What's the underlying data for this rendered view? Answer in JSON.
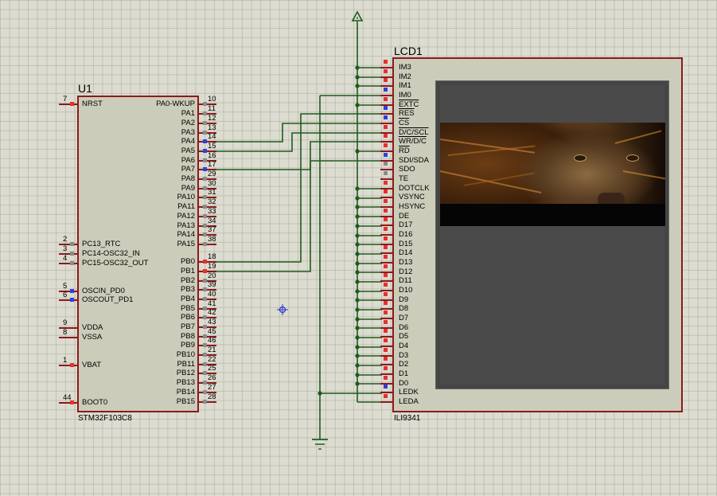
{
  "u1": {
    "ref": "U1",
    "part": "STM32F103C8",
    "left_pins": [
      {
        "num": "7",
        "label": "NRST",
        "marker": "red"
      },
      {
        "num": "2",
        "label": "PC13_RTC",
        "marker": "gray"
      },
      {
        "num": "3",
        "label": "PC14-OSC32_IN",
        "marker": "gray"
      },
      {
        "num": "4",
        "label": "PC15-OSC32_OUT",
        "marker": "gray"
      },
      {
        "num": "5",
        "label": "OSCIN_PD0",
        "marker": "blue"
      },
      {
        "num": "6",
        "label": "OSCOUT_PD1",
        "marker": "blue"
      },
      {
        "num": "9",
        "label": "VDDA",
        "marker": "none"
      },
      {
        "num": "8",
        "label": "VSSA",
        "marker": "none"
      },
      {
        "num": "1",
        "label": "VBAT",
        "marker": "red"
      },
      {
        "num": "44",
        "label": "BOOT0",
        "marker": "red"
      }
    ],
    "right_pins": [
      {
        "num": "10",
        "label": "PA0-WKUP",
        "marker": "gray"
      },
      {
        "num": "11",
        "label": "PA1",
        "marker": "gray"
      },
      {
        "num": "12",
        "label": "PA2",
        "marker": "gray"
      },
      {
        "num": "13",
        "label": "PA3",
        "marker": "gray"
      },
      {
        "num": "14",
        "label": "PA4",
        "marker": "blue"
      },
      {
        "num": "15",
        "label": "PA5",
        "marker": "blue"
      },
      {
        "num": "16",
        "label": "PA6",
        "marker": "gray"
      },
      {
        "num": "17",
        "label": "PA7",
        "marker": "blue"
      },
      {
        "num": "29",
        "label": "PA8",
        "marker": "gray"
      },
      {
        "num": "30",
        "label": "PA9",
        "marker": "gray"
      },
      {
        "num": "31",
        "label": "PA10",
        "marker": "gray"
      },
      {
        "num": "32",
        "label": "PA11",
        "marker": "gray"
      },
      {
        "num": "33",
        "label": "PA12",
        "marker": "gray"
      },
      {
        "num": "34",
        "label": "PA13",
        "marker": "gray"
      },
      {
        "num": "37",
        "label": "PA14",
        "marker": "gray"
      },
      {
        "num": "38",
        "label": "PA15",
        "marker": "gray"
      },
      {
        "num": "18",
        "label": "PB0",
        "marker": "red"
      },
      {
        "num": "19",
        "label": "PB1",
        "marker": "red"
      },
      {
        "num": "20",
        "label": "PB2",
        "marker": "gray"
      },
      {
        "num": "39",
        "label": "PB3",
        "marker": "gray"
      },
      {
        "num": "40",
        "label": "PB4",
        "marker": "gray"
      },
      {
        "num": "41",
        "label": "PB5",
        "marker": "gray"
      },
      {
        "num": "42",
        "label": "PB6",
        "marker": "gray"
      },
      {
        "num": "43",
        "label": "PB7",
        "marker": "gray"
      },
      {
        "num": "45",
        "label": "PB8",
        "marker": "gray"
      },
      {
        "num": "46",
        "label": "PB9",
        "marker": "gray"
      },
      {
        "num": "21",
        "label": "PB10",
        "marker": "gray"
      },
      {
        "num": "22",
        "label": "PB11",
        "marker": "gray"
      },
      {
        "num": "25",
        "label": "PB12",
        "marker": "gray"
      },
      {
        "num": "26",
        "label": "PB13",
        "marker": "gray"
      },
      {
        "num": "27",
        "label": "PB14",
        "marker": "gray"
      },
      {
        "num": "28",
        "label": "PB15",
        "marker": "gray"
      }
    ]
  },
  "lcd": {
    "ref": "LCD1",
    "part": "ILI9341",
    "pins": [
      {
        "label": "IM3",
        "marker": "red",
        "overline": false
      },
      {
        "label": "IM2",
        "marker": "red",
        "overline": false
      },
      {
        "label": "IM1",
        "marker": "red",
        "overline": false
      },
      {
        "label": "IM0",
        "marker": "blue",
        "overline": false
      },
      {
        "label": "EXTC",
        "marker": "red",
        "overline": true
      },
      {
        "label": "RES",
        "marker": "blue",
        "overline": true
      },
      {
        "label": "CS",
        "marker": "blue",
        "overline": true
      },
      {
        "label": "D/C/SCL",
        "marker": "red",
        "overline": true
      },
      {
        "label": "WR/D/C",
        "marker": "red",
        "overline": true
      },
      {
        "label": "RD",
        "marker": "red",
        "overline": true
      },
      {
        "label": "SDI/SDA",
        "marker": "blue",
        "overline": false
      },
      {
        "label": "SDO",
        "marker": "gray",
        "overline": false
      },
      {
        "label": "TE",
        "marker": "gray",
        "overline": false
      },
      {
        "label": "DOTCLK",
        "marker": "red",
        "overline": false
      },
      {
        "label": "VSYNC",
        "marker": "red",
        "overline": false
      },
      {
        "label": "HSYNC",
        "marker": "red",
        "overline": false
      },
      {
        "label": "DE",
        "marker": "red",
        "overline": false
      },
      {
        "label": "D17",
        "marker": "red",
        "overline": false
      },
      {
        "label": "D16",
        "marker": "red",
        "overline": false
      },
      {
        "label": "D15",
        "marker": "red",
        "overline": false
      },
      {
        "label": "D14",
        "marker": "red",
        "overline": false
      },
      {
        "label": "D13",
        "marker": "red",
        "overline": false
      },
      {
        "label": "D12",
        "marker": "red",
        "overline": false
      },
      {
        "label": "D11",
        "marker": "red",
        "overline": false
      },
      {
        "label": "D10",
        "marker": "red",
        "overline": false
      },
      {
        "label": "D9",
        "marker": "red",
        "overline": false
      },
      {
        "label": "D8",
        "marker": "red",
        "overline": false
      },
      {
        "label": "D7",
        "marker": "red",
        "overline": false
      },
      {
        "label": "D6",
        "marker": "red",
        "overline": false
      },
      {
        "label": "D5",
        "marker": "red",
        "overline": false
      },
      {
        "label": "D4",
        "marker": "red",
        "overline": false
      },
      {
        "label": "D3",
        "marker": "red",
        "overline": false
      },
      {
        "label": "D2",
        "marker": "red",
        "overline": false
      },
      {
        "label": "D1",
        "marker": "red",
        "overline": false
      },
      {
        "label": "D0",
        "marker": "red",
        "overline": false
      },
      {
        "label": "LEDK",
        "marker": "blue",
        "overline": false
      },
      {
        "label": "LEDA",
        "marker": "red",
        "overline": false
      }
    ],
    "screen_image": "lion-face-photo"
  },
  "symbols": {
    "power": "power-terminal-icon",
    "ground": "ground-icon",
    "cursor": "crosshair-cursor-icon"
  },
  "colors": {
    "background": "#dcdcd0",
    "wire": "#1e5a1e",
    "component_border": "#8b1a1a",
    "component_fill": "#ccccba",
    "pin_red": "#e53030",
    "pin_blue": "#2f3fe0",
    "pin_gray": "#8a8a8a"
  }
}
